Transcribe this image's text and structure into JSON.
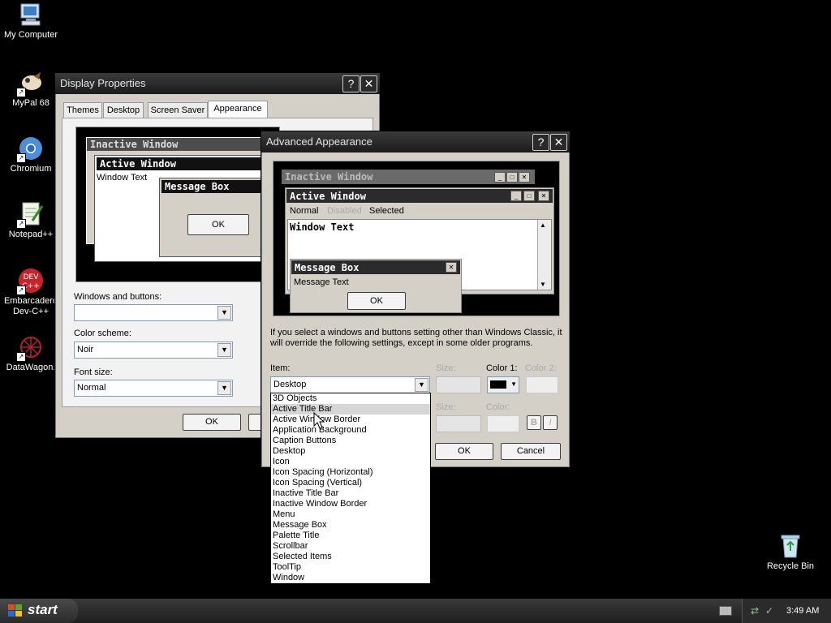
{
  "desktop": {
    "icons": [
      {
        "label": "My Computer"
      },
      {
        "label": "MyPal 68"
      },
      {
        "label": "Chromium"
      },
      {
        "label": "Notepad++"
      },
      {
        "label": "Embarcadero Dev-C++"
      },
      {
        "label": "DataWagon."
      },
      {
        "label": "Recycle Bin"
      }
    ]
  },
  "display_props": {
    "title": "Display Properties",
    "help": "?",
    "close": "✕",
    "tabs": [
      "Themes",
      "Desktop",
      "Screen Saver",
      "Appearance"
    ],
    "preview": {
      "inactive": "Inactive Window",
      "active": "Active Window",
      "window_text": "Window Text",
      "msgbox": "Message Box",
      "ok": "OK"
    },
    "windows_buttons_label": "Windows and buttons:",
    "windows_buttons_value": "",
    "color_scheme_label": "Color scheme:",
    "color_scheme_value": "Noir",
    "font_size_label": "Font size:",
    "font_size_value": "Normal",
    "ok_label": "OK"
  },
  "advanced": {
    "title": "Advanced Appearance",
    "help": "?",
    "close": "✕",
    "preview": {
      "inactive": "Inactive Window",
      "active": "Active Window",
      "menu_normal": "Normal",
      "menu_disabled": "Disabled",
      "menu_selected": "Selected",
      "window_text": "Window Text",
      "msgbox": "Message Box",
      "msg_text": "Message Text",
      "ok": "OK"
    },
    "info_text": "If you select a windows and buttons setting other than Windows Classic, it will override the following settings, except in some older programs.",
    "item_label": "Item:",
    "item_value": "Desktop",
    "size_label": "Size:",
    "color1_label": "Color 1:",
    "color2_label": "Color 2:",
    "font_size_label": "Size:",
    "font_color_label": "Color:",
    "bold": "B",
    "italic": "I",
    "ok_label": "OK",
    "cancel_label": "Cancel",
    "items": [
      "3D Objects",
      "Active Title Bar",
      "Active Window Border",
      "Application Background",
      "Caption Buttons",
      "Desktop",
      "Icon",
      "Icon Spacing (Horizontal)",
      "Icon Spacing (Vertical)",
      "Inactive Title Bar",
      "Inactive Window Border",
      "Menu",
      "Message Box",
      "Palette Title",
      "Scrollbar",
      "Selected Items",
      "ToolTip",
      "Window"
    ],
    "selected_index": 1
  },
  "taskbar": {
    "start_label": "start",
    "time": "3:49 AM"
  }
}
